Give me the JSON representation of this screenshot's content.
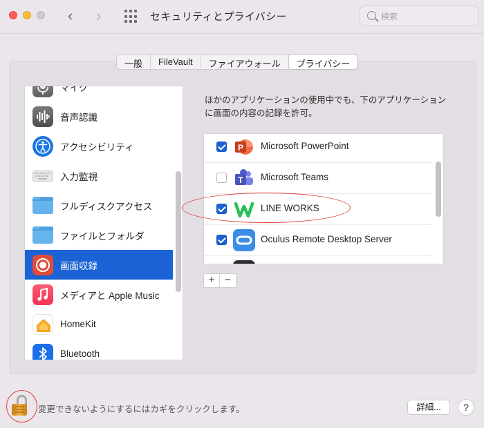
{
  "window": {
    "title": "セキュリティとプライバシー",
    "traffic_lights": [
      "close",
      "minimize",
      "zoom"
    ],
    "nav_back": "‹",
    "nav_forward": "›",
    "search_placeholder": "検索"
  },
  "tabs": [
    {
      "label": "一般",
      "active": false
    },
    {
      "label": "FileVault",
      "active": false
    },
    {
      "label": "ファイアウォール",
      "active": false
    },
    {
      "label": "プライバシー",
      "active": true
    }
  ],
  "sidebar": {
    "items": [
      {
        "label": "マイク",
        "icon": "microphone-icon",
        "selected": false
      },
      {
        "label": "音声認識",
        "icon": "voice-recognition-icon",
        "selected": false
      },
      {
        "label": "アクセシビリティ",
        "icon": "accessibility-icon",
        "selected": false
      },
      {
        "label": "入力監視",
        "icon": "keyboard-icon",
        "selected": false
      },
      {
        "label": "フルディスクアクセス",
        "icon": "folder-icon",
        "selected": false
      },
      {
        "label": "ファイルとフォルダ",
        "icon": "folder-icon",
        "selected": false
      },
      {
        "label": "画面収録",
        "icon": "screen-recording-icon",
        "selected": true
      },
      {
        "label": "メディアと Apple Music",
        "icon": "music-icon",
        "selected": false
      },
      {
        "label": "HomeKit",
        "icon": "homekit-icon",
        "selected": false
      },
      {
        "label": "Bluetooth",
        "icon": "bluetooth-icon",
        "selected": false
      }
    ]
  },
  "content": {
    "description": "ほかのアプリケーションの使用中でも、下のアプリケーションに画面の内容の記録を許可。",
    "apps": [
      {
        "name": "Microsoft PowerPoint",
        "checked": true,
        "icon": "powerpoint-icon"
      },
      {
        "name": "Microsoft Teams",
        "checked": false,
        "icon": "teams-icon"
      },
      {
        "name": "LINE WORKS",
        "checked": true,
        "icon": "lineworks-icon"
      },
      {
        "name": "Oculus Remote Desktop Server",
        "checked": true,
        "icon": "oculus-icon"
      }
    ],
    "add_label": "+",
    "remove_label": "−"
  },
  "footer": {
    "lock_text": "変更できないようにするにはカギをクリックします。",
    "detail_label": "詳細...",
    "help_label": "?"
  },
  "colors": {
    "accent": "#1b63d4",
    "annotation": "#e0463a"
  }
}
